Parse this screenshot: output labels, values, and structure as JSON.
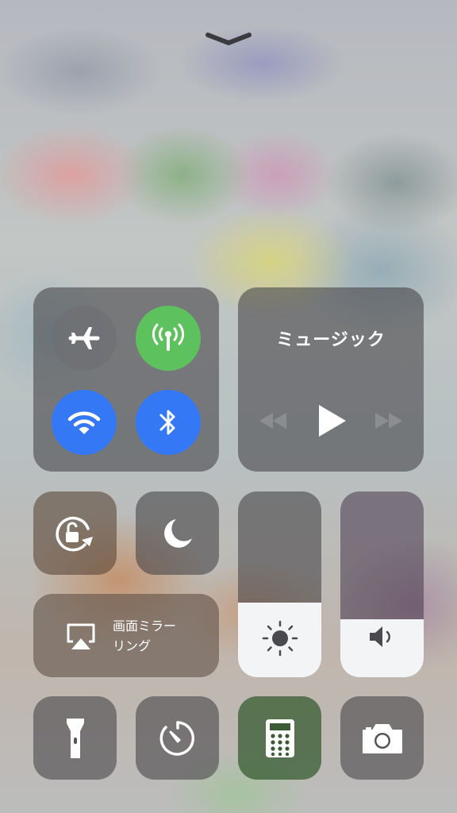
{
  "grabber": {
    "icon": "chevron-down-icon"
  },
  "connectivity": {
    "airplane_mode": {
      "icon": "airplane-icon",
      "active": false
    },
    "cellular_data": {
      "icon": "antenna-icon",
      "active": true,
      "color": "#5dc25d"
    },
    "wifi": {
      "icon": "wifi-icon",
      "active": true,
      "color": "#3478f5"
    },
    "bluetooth": {
      "icon": "bluetooth-icon",
      "active": true,
      "color": "#3478f5"
    }
  },
  "music": {
    "title": "ミュージック",
    "controls": [
      "rewind-icon",
      "play-icon",
      "fast-forward-icon"
    ]
  },
  "rotation_lock": {
    "icon": "rotation-lock-icon"
  },
  "do_not_disturb": {
    "icon": "moon-icon"
  },
  "screen_mirroring": {
    "label": "画面ミラー\nリング",
    "icon": "airplay-icon"
  },
  "brightness": {
    "icon": "sun-icon",
    "level": 0.4
  },
  "volume": {
    "icon": "speaker-icon",
    "level": 0.31
  },
  "bottom_row": [
    "flashlight-icon",
    "timer-icon",
    "calculator-icon",
    "camera-icon"
  ]
}
